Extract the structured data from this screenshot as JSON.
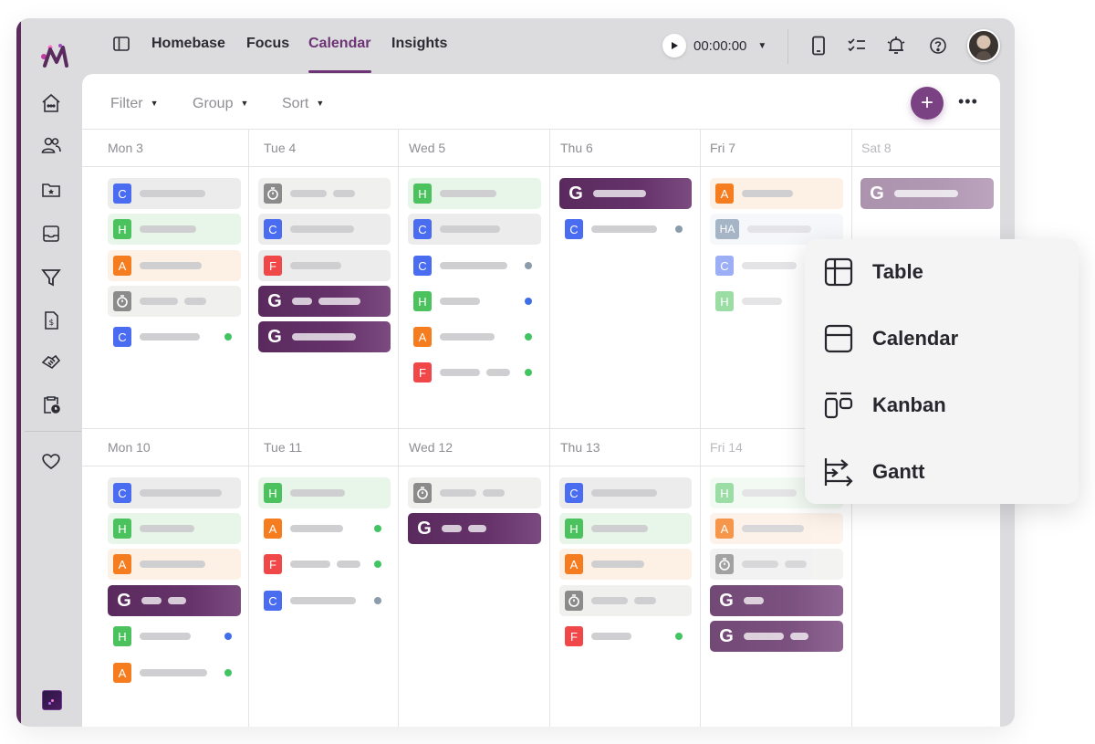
{
  "nav": {
    "tabs": [
      {
        "label": "Homebase"
      },
      {
        "label": "Focus"
      },
      {
        "label": "Calendar",
        "active": true
      },
      {
        "label": "Insights"
      }
    ],
    "timer": "00:00:00"
  },
  "toolbar": {
    "filter": "Filter",
    "group": "Group",
    "sort": "Sort",
    "add": "+",
    "more": "•••"
  },
  "calendar": {
    "week1": [
      "Mon 3",
      "Tue 4",
      "Wed 5",
      "Thu 6",
      "Fri 7",
      "Sat 8"
    ],
    "week2": [
      "Mon 10",
      "Tue 11",
      "Wed 12",
      "Thu 13",
      "Fri 14"
    ],
    "badges": {
      "c": "C",
      "h": "H",
      "a": "A",
      "f": "F",
      "ha": "HA",
      "g": "G"
    }
  },
  "view_menu": {
    "items": [
      "Table",
      "Calendar",
      "Kanban",
      "Gantt"
    ]
  },
  "colors": {
    "accent": "#6c3475",
    "badge_c": "#4a6cf0",
    "badge_h": "#4cc25e",
    "badge_a": "#f57c1f",
    "badge_f": "#f04848",
    "badge_timer": "#8b8b8b",
    "card_c": "#ececec",
    "card_h": "#e8f6ea",
    "card_a": "#fdf0e5",
    "card_timer": "#f0f0ef",
    "dot_green": "#43c463",
    "dot_blue": "#3f6ee8",
    "dot_gray": "#8b9cad"
  }
}
